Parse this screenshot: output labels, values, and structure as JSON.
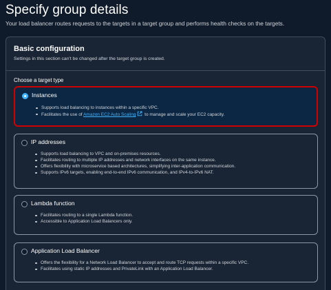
{
  "header": {
    "title": "Specify group details",
    "subtitle": "Your load balancer routes requests to the targets in a target group and performs health checks on the targets."
  },
  "basic_config": {
    "title": "Basic configuration",
    "description": "Settings in this section can't be changed after the target group is created.",
    "target_type_label": "Choose a target type",
    "options": [
      {
        "label": "Instances",
        "selected": true,
        "bullets": [
          "Supports load balancing to instances within a specific VPC.",
          "Facilitates the use of",
          "to manage and scale your EC2 capacity."
        ],
        "link_text": "Amazon EC2 Auto Scaling"
      },
      {
        "label": "IP addresses",
        "selected": false,
        "bullets": [
          "Supports load balancing to VPC and on-premises resources.",
          "Facilitates routing to multiple IP addresses and network interfaces on the same instance.",
          "Offers flexibility with microservice based architectures, simplifying inter-application communication.",
          "Supports IPv6 targets, enabling end-to-end IPv6 communication, and IPv4-to-IPv6 NAT."
        ]
      },
      {
        "label": "Lambda function",
        "selected": false,
        "bullets": [
          "Facilitates routing to a single Lambda function.",
          "Accessible to Application Load Balancers only."
        ]
      },
      {
        "label": "Application Load Balancer",
        "selected": false,
        "bullets": [
          "Offers the flexibility for a Network Load Balancer to accept and route TCP requests within a specific VPC.",
          "Facilitates using static IP addresses and PrivateLink with an Application Load Balancer."
        ]
      }
    ]
  },
  "colors": {
    "background": "#0f1b2a",
    "panel": "#192534",
    "selected_tile": "#0b2743",
    "highlight_border": "#d10000",
    "accent_link": "#42b4ff"
  },
  "icons": [
    "external-link-icon"
  ]
}
